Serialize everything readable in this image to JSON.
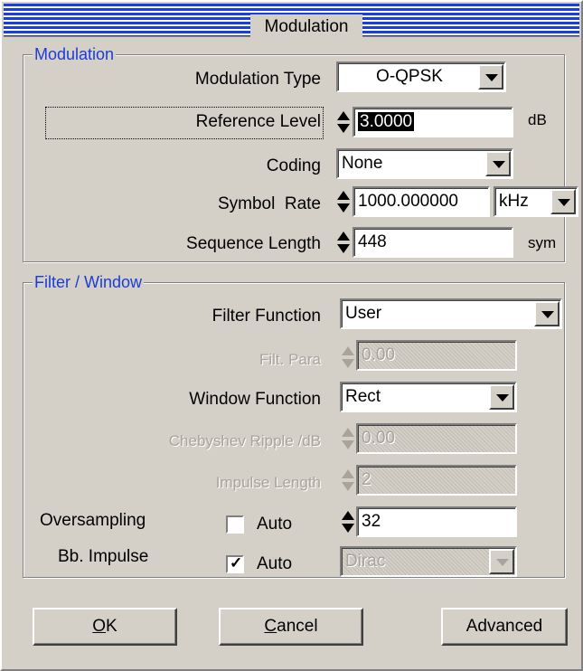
{
  "window": {
    "title": "Modulation"
  },
  "modulation_group": {
    "title": "Modulation",
    "modulation_type": {
      "label": "Modulation Type",
      "value": "O-QPSK"
    },
    "reference_level": {
      "label": "Reference Level",
      "value": "3.0000",
      "unit": "dB"
    },
    "coding": {
      "label": "Coding",
      "value": "None"
    },
    "symbol_rate": {
      "label": "Symbol  Rate",
      "value": "1000.000000",
      "unit": "kHz"
    },
    "sequence_length": {
      "label": "Sequence Length",
      "value": "448",
      "unit": "sym"
    }
  },
  "filter_group": {
    "title": "Filter / Window",
    "filter_function": {
      "label": "Filter Function",
      "value": "User"
    },
    "filt_para": {
      "label": "Filt. Para",
      "value": "0.00"
    },
    "window_function": {
      "label": "Window Function",
      "value": "Rect"
    },
    "chebyshev_ripple": {
      "label": "Chebyshev Ripple /dB",
      "value": "0.00"
    },
    "impulse_length": {
      "label": "Impulse Length",
      "value": "2"
    },
    "oversampling": {
      "label": "Oversampling",
      "auto_label": "Auto",
      "auto_checked": false,
      "value": "32"
    },
    "bb_impulse": {
      "label": "Bb. Impulse",
      "auto_label": "Auto",
      "auto_checked": true,
      "value": "Dirac"
    }
  },
  "buttons": {
    "ok_accel": "O",
    "ok_rest": "K",
    "cancel_accel": "C",
    "cancel_rest": "ancel",
    "advanced": "Advanced"
  },
  "icons": {
    "checkmark": "✓"
  }
}
